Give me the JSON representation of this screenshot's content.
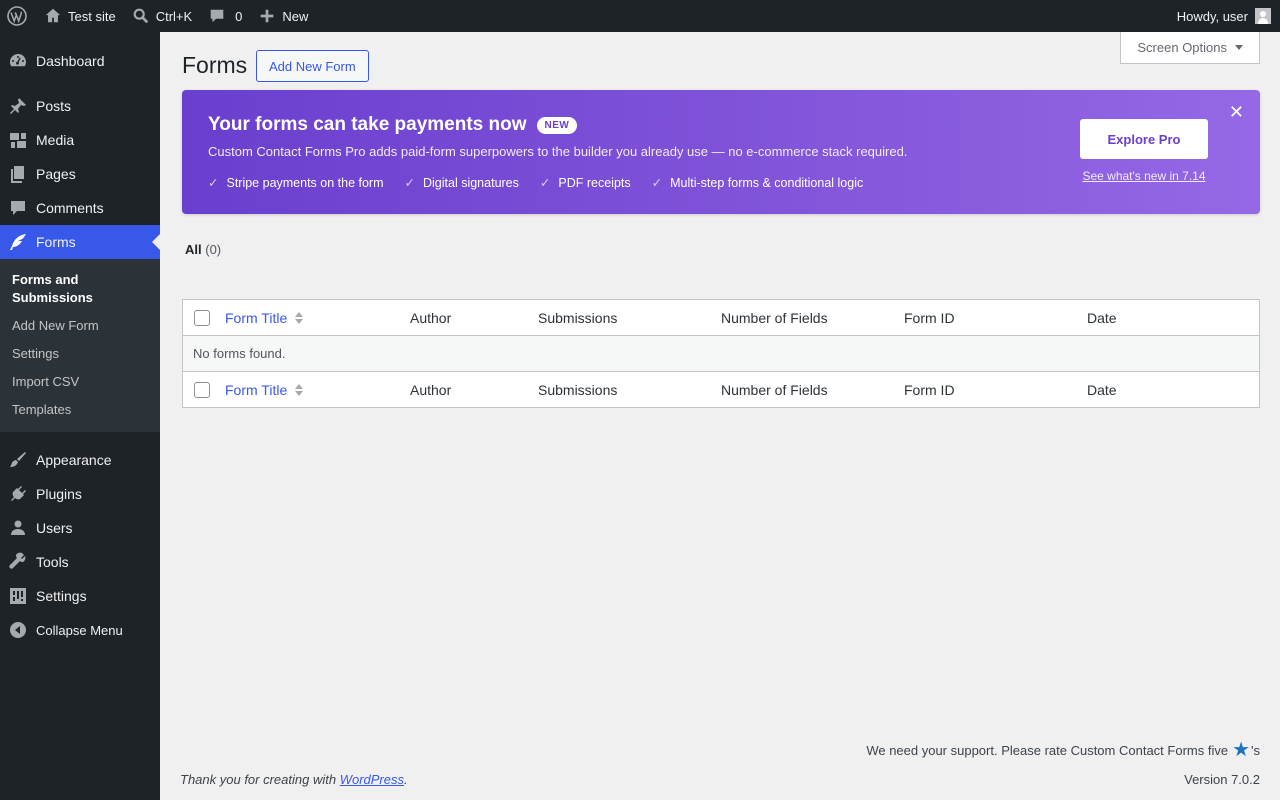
{
  "adminbar": {
    "site_name": "Test site",
    "search_shortcut": "Ctrl+K",
    "comments_count": "0",
    "new_label": "New",
    "greeting": "Howdy, user"
  },
  "sidebar": {
    "items": [
      {
        "label": "Dashboard"
      },
      {
        "label": "Posts"
      },
      {
        "label": "Media"
      },
      {
        "label": "Pages"
      },
      {
        "label": "Comments"
      },
      {
        "label": "Forms"
      },
      {
        "label": "Appearance"
      },
      {
        "label": "Plugins"
      },
      {
        "label": "Users"
      },
      {
        "label": "Tools"
      },
      {
        "label": "Settings"
      },
      {
        "label": "Collapse Menu"
      }
    ],
    "forms_submenu": [
      {
        "label": "Forms and Submissions"
      },
      {
        "label": "Add New Form"
      },
      {
        "label": "Settings"
      },
      {
        "label": "Import CSV"
      },
      {
        "label": "Templates"
      }
    ]
  },
  "header": {
    "screen_options": "Screen Options",
    "title": "Forms",
    "add_new": "Add New Form"
  },
  "banner": {
    "title": "Your forms can take payments now",
    "badge": "NEW",
    "description": "Custom Contact Forms Pro adds paid-form superpowers to the builder you already use — no e-commerce stack required.",
    "features": [
      "Stripe payments on the form",
      "Digital signatures",
      "PDF receipts",
      "Multi-step forms & conditional logic"
    ],
    "cta": "Explore Pro",
    "link": "See what's new in 7.14",
    "close": "✕",
    "check": "✓"
  },
  "views": {
    "all_label": "All",
    "all_count": "(0)"
  },
  "table": {
    "columns": [
      "Form Title",
      "Author",
      "Submissions",
      "Number of Fields",
      "Form ID",
      "Date"
    ],
    "empty_message": "No forms found."
  },
  "footer": {
    "rate_text": "We need your support. Please rate Custom Contact Forms five",
    "rate_suffix": "'s",
    "thanks_prefix": "Thank you for creating with ",
    "thanks_link": "WordPress",
    "thanks_suffix": ".",
    "version": "Version 7.0.2"
  },
  "colors": {
    "accent": "#3858e9",
    "sidebar_bg": "#1d2327",
    "banner_start": "#6a3fce",
    "banner_end": "#9568e6"
  }
}
